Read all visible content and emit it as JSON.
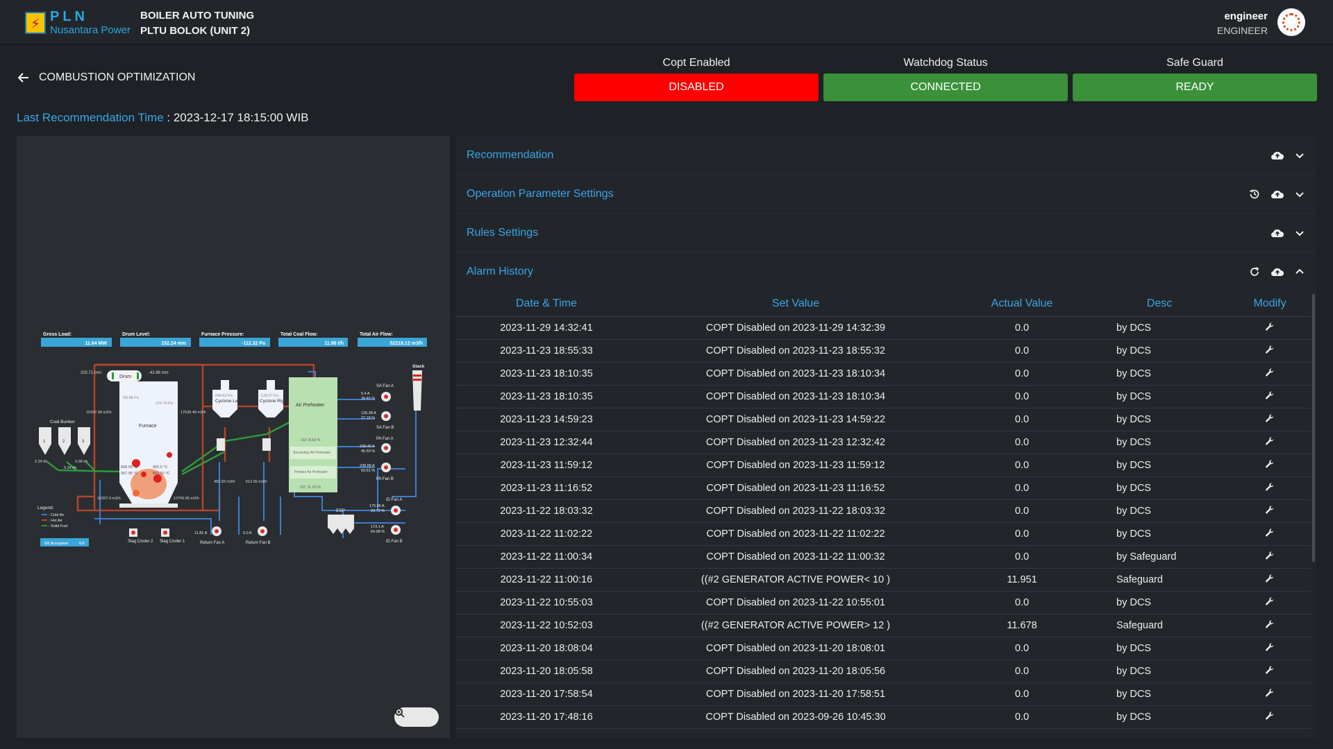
{
  "brand": {
    "logo_letters": "PLN",
    "logo_sub": "Nusantara Power"
  },
  "app": {
    "title_line1": "BOILER AUTO TUNING",
    "title_line2": "PLTU BOLOK (UNIT 2)"
  },
  "user": {
    "name": "engineer",
    "role": "ENGINEER"
  },
  "page": {
    "title": "COMBUSTION OPTIMIZATION"
  },
  "status": [
    {
      "label": "Copt Enabled",
      "value": "DISABLED",
      "color": "#ff0000"
    },
    {
      "label": "Watchdog Status",
      "value": "CONNECTED",
      "color": "#3a913a"
    },
    {
      "label": "Safe Guard",
      "value": "READY",
      "color": "#3a913a"
    }
  ],
  "last_recommendation": {
    "label": "Last Recommendation Time",
    "value": " : 2023-12-17 18:15:00 WIB"
  },
  "diagram": {
    "cards": [
      {
        "label": "Gross Load:",
        "value": "11.64 MW"
      },
      {
        "label": "Drum Level:",
        "value": "152.24 mm"
      },
      {
        "label": "Furnace Pressure:",
        "value": "-112.32 Pa"
      },
      {
        "label": "Total Coal Flow:",
        "value": "11.96 t/h"
      },
      {
        "label": "Total Air Flow:",
        "value": "52218.12 m3/h"
      }
    ],
    "labels": {
      "drum": "Drum",
      "drum_left": "202.71 mm",
      "drum_right": "-42.86 mm",
      "furnace": "Furnace",
      "furnace_p1": "-99.88 Pa",
      "furnace_p2": "-124.79 Pa",
      "cyclone_left": "Cyclone Left",
      "cyclone_right": "Cyclone Right",
      "cyc_l_val": "-249.62 Pa",
      "cyc_r_val": "-138.27 Pa",
      "air_preheater": "Air Preheater",
      "o2_top": "O2: 8.53 %",
      "secondary": "Secondary Air Preheater",
      "primary": "Primary Air Preheater",
      "o2_bottom": "O2: 11.23 %",
      "coal_bunker": "Coal Bunker",
      "b1": "1",
      "b2": "2",
      "b3": "3",
      "flow1": "15347.99 m3/h",
      "flow2": "17538.48 m3/h",
      "flow3": "16337.0 m3/h",
      "flow4": "13706.96 m3/h",
      "flow5": "482.93 m3/h",
      "flow6": "612.06 m3/h",
      "bunk_a": "2.24 t/h",
      "bunk_b": "4.38 t/h",
      "bunk_c": "5.34 t/h",
      "t1": "838.56 °C",
      "t2": "955.6 °C",
      "t3": "957.95 °C",
      "t4": "883.52 °C",
      "stack": "Stack",
      "esp": "ESP",
      "sa_fan_a": "SA Fan A",
      "sa_fan_b": "SA Fan B",
      "pa_fan_a": "PA Fan A",
      "pa_fan_b": "PA Fan B",
      "id_fan_a": "ID Fan A",
      "id_fan_b": "ID Fan B",
      "saa_1": "5.4 A",
      "saa_2": "28.45 %",
      "sab_1": "135.38 A",
      "sab_2": "27.18 %",
      "paa_1": "238.46 A",
      "paa_2": "45.59 %",
      "pab_1": "238.89 A",
      "pab_2": "60.61 %",
      "ida_1": "175.86 A",
      "ida_2": "23.72 %",
      "idb_1": "173.1 A",
      "idb_2": "64.98 %",
      "slag2": "Slag Cooler 2",
      "slag1": "Slag Cooler 1",
      "rfa": "Return Fan A",
      "rfb": "Return Fan B",
      "rfa_val": "11.81 A",
      "rfb_val": "0.0 A",
      "legend": "Legend:",
      "cold_air": ": Cold Air",
      "hot_air": ": Hot Air",
      "solid_fuel": ": Solid Fuel",
      "o2_accepted": "O2 Accepted:",
      "o2_accepted_val": "0.0"
    },
    "colors": {
      "cold_air": "#3b7fd0",
      "hot_air": "#b4442c",
      "solid_fuel": "#2e9a3c"
    }
  },
  "panels": [
    {
      "title": "Recommendation",
      "icons": [
        "cloud-upload-icon",
        "chevron-down-icon"
      ]
    },
    {
      "title": "Operation Parameter Settings",
      "icons": [
        "history-icon",
        "cloud-upload-icon",
        "chevron-down-icon"
      ]
    },
    {
      "title": "Rules Settings",
      "icons": [
        "cloud-upload-icon",
        "chevron-down-icon"
      ]
    },
    {
      "title": "Alarm History",
      "icons": [
        "refresh-icon",
        "cloud-upload-icon",
        "chevron-up-icon"
      ]
    }
  ],
  "alarm_table": {
    "columns": [
      "Date & Time",
      "Set Value",
      "Actual Value",
      "Desc",
      "Modify"
    ],
    "rows": [
      [
        "2023-11-29 14:32:41",
        "COPT Disabled on 2023-11-29 14:32:39",
        "0.0",
        "by DCS"
      ],
      [
        "2023-11-23 18:55:33",
        "COPT Disabled on 2023-11-23 18:55:32",
        "0.0",
        "by DCS"
      ],
      [
        "2023-11-23 18:10:35",
        "COPT Disabled on 2023-11-23 18:10:34",
        "0.0",
        "by DCS"
      ],
      [
        "2023-11-23 18:10:35",
        "COPT Disabled on 2023-11-23 18:10:34",
        "0.0",
        "by DCS"
      ],
      [
        "2023-11-23 14:59:23",
        "COPT Disabled on 2023-11-23 14:59:22",
        "0.0",
        "by DCS"
      ],
      [
        "2023-11-23 12:32:44",
        "COPT Disabled on 2023-11-23 12:32:42",
        "0.0",
        "by DCS"
      ],
      [
        "2023-11-23 11:59:12",
        "COPT Disabled on 2023-11-23 11:59:12",
        "0.0",
        "by DCS"
      ],
      [
        "2023-11-23 11:16:52",
        "COPT Disabled on 2023-11-23 11:16:52",
        "0.0",
        "by DCS"
      ],
      [
        "2023-11-22 18:03:32",
        "COPT Disabled on 2023-11-22 18:03:32",
        "0.0",
        "by DCS"
      ],
      [
        "2023-11-22 11:02:22",
        "COPT Disabled on 2023-11-22 11:02:22",
        "0.0",
        "by DCS"
      ],
      [
        "2023-11-22 11:00:34",
        "COPT Disabled on 2023-11-22 11:00:32",
        "0.0",
        "by Safeguard"
      ],
      [
        "2023-11-22 11:00:16",
        "((#2 GENERATOR ACTIVE POWER< 10 )",
        "11.951",
        "Safeguard"
      ],
      [
        "2023-11-22 10:55:03",
        "COPT Disabled on 2023-11-22 10:55:01",
        "0.0",
        "by DCS"
      ],
      [
        "2023-11-22 10:52:03",
        "((#2 GENERATOR ACTIVE POWER> 12 )",
        "11.678",
        "Safeguard"
      ],
      [
        "2023-11-20 18:08:04",
        "COPT Disabled on 2023-11-20 18:08:01",
        "0.0",
        "by DCS"
      ],
      [
        "2023-11-20 18:05:58",
        "COPT Disabled on 2023-11-20 18:05:56",
        "0.0",
        "by DCS"
      ],
      [
        "2023-11-20 17:58:54",
        "COPT Disabled on 2023-11-20 17:58:51",
        "0.0",
        "by DCS"
      ],
      [
        "2023-11-20 17:48:16",
        "COPT Disabled on 2023-09-26 10:45:30",
        "0.0",
        "by DCS"
      ]
    ]
  }
}
